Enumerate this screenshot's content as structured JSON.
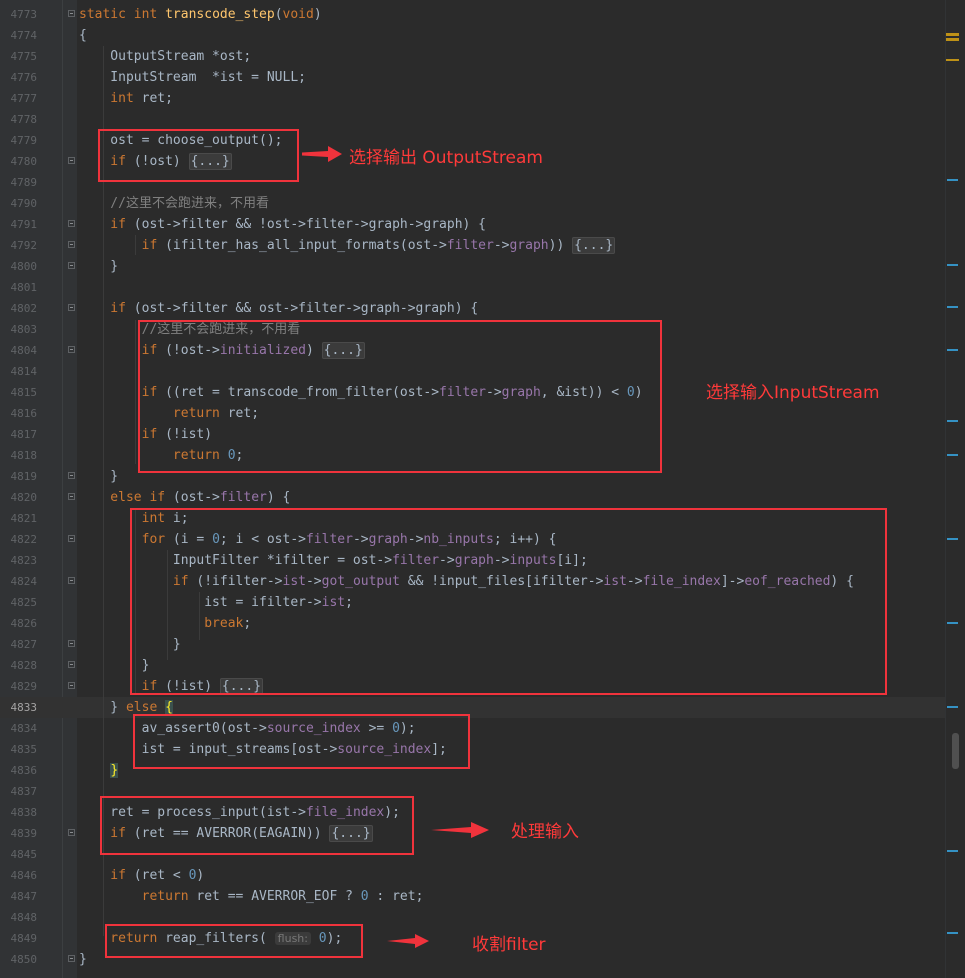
{
  "editor": {
    "lines": [
      {
        "n": "4773",
        "fold": true,
        "tokens": [
          [
            "kw",
            "static "
          ],
          [
            "kw",
            "int "
          ],
          [
            "fn",
            "transcode_step"
          ],
          [
            "",
            "("
          ],
          [
            "kw",
            "void"
          ],
          [
            "",
            ")"
          ]
        ]
      },
      {
        "n": "4774",
        "tokens": [
          [
            "",
            "{"
          ]
        ]
      },
      {
        "n": "4775",
        "tokens": [
          [
            "",
            "    OutputStream *ost;"
          ]
        ]
      },
      {
        "n": "4776",
        "tokens": [
          [
            "",
            "    InputStream  *ist = NULL;"
          ]
        ]
      },
      {
        "n": "4777",
        "tokens": [
          [
            "kw",
            "    int "
          ],
          [
            "",
            "ret;"
          ]
        ]
      },
      {
        "n": "4778",
        "tokens": []
      },
      {
        "n": "4779",
        "tokens": [
          [
            "",
            "    ost = choose_output();"
          ]
        ]
      },
      {
        "n": "4780",
        "fold": true,
        "tokens": [
          [
            "kw",
            "    if "
          ],
          [
            "",
            "(!ost) "
          ],
          [
            "fold",
            "{...}"
          ]
        ]
      },
      {
        "n": "4789",
        "tokens": []
      },
      {
        "n": "4790",
        "tokens": [
          [
            "cm",
            "    //这里不会跑进来，不用看"
          ]
        ]
      },
      {
        "n": "4791",
        "fold": true,
        "tokens": [
          [
            "kw",
            "    if "
          ],
          [
            "",
            "(ost->filter && !ost->filter->graph->graph) {"
          ]
        ]
      },
      {
        "n": "4792",
        "fold": true,
        "tokens": [
          [
            "kw",
            "        if "
          ],
          [
            "",
            "(ifilter_has_all_input_formats(ost->"
          ],
          [
            "fld",
            "filter"
          ],
          [
            "",
            "->"
          ],
          [
            "fld",
            "graph"
          ],
          [
            "",
            ")) "
          ],
          [
            "fold",
            "{...}"
          ]
        ]
      },
      {
        "n": "4800",
        "fold": true,
        "tokens": [
          [
            "",
            "    }"
          ]
        ]
      },
      {
        "n": "4801",
        "tokens": []
      },
      {
        "n": "4802",
        "fold": true,
        "tokens": [
          [
            "kw",
            "    if "
          ],
          [
            "",
            "(ost->filter && ost->filter->graph->graph) {"
          ]
        ]
      },
      {
        "n": "4803",
        "tokens": [
          [
            "cm",
            "        //这里不会跑进来，不用看"
          ]
        ]
      },
      {
        "n": "4804",
        "fold": true,
        "tokens": [
          [
            "kw",
            "        if "
          ],
          [
            "",
            "(!ost->"
          ],
          [
            "fld",
            "initialized"
          ],
          [
            "",
            ") "
          ],
          [
            "fold",
            "{...}"
          ]
        ]
      },
      {
        "n": "4814",
        "tokens": []
      },
      {
        "n": "4815",
        "tokens": [
          [
            "kw",
            "        if "
          ],
          [
            "",
            "((ret = transcode_from_filter(ost->"
          ],
          [
            "fld",
            "filter"
          ],
          [
            "",
            "->"
          ],
          [
            "fld",
            "graph"
          ],
          [
            "",
            ", &ist)) < "
          ],
          [
            "num",
            "0"
          ],
          [
            "",
            ")"
          ]
        ]
      },
      {
        "n": "4816",
        "tokens": [
          [
            "kw",
            "            return "
          ],
          [
            "",
            "ret;"
          ]
        ]
      },
      {
        "n": "4817",
        "tokens": [
          [
            "kw",
            "        if "
          ],
          [
            "",
            "(!ist)"
          ]
        ]
      },
      {
        "n": "4818",
        "tokens": [
          [
            "kw",
            "            return "
          ],
          [
            "num",
            "0"
          ],
          [
            "",
            ";"
          ]
        ]
      },
      {
        "n": "4819",
        "fold": true,
        "tokens": [
          [
            "",
            "    }"
          ]
        ]
      },
      {
        "n": "4820",
        "fold": true,
        "tokens": [
          [
            "kw",
            "    else if "
          ],
          [
            "",
            "(ost->"
          ],
          [
            "fld",
            "filter"
          ],
          [
            "",
            ") {"
          ]
        ]
      },
      {
        "n": "4821",
        "tokens": [
          [
            "kw",
            "        int "
          ],
          [
            "",
            "i;"
          ]
        ]
      },
      {
        "n": "4822",
        "fold": true,
        "tokens": [
          [
            "kw",
            "        for "
          ],
          [
            "",
            "(i = "
          ],
          [
            "num",
            "0"
          ],
          [
            "",
            "; i < ost->"
          ],
          [
            "fld",
            "filter"
          ],
          [
            "",
            "->"
          ],
          [
            "fld",
            "graph"
          ],
          [
            "",
            "->"
          ],
          [
            "fld",
            "nb_inputs"
          ],
          [
            "",
            "; i++) {"
          ]
        ]
      },
      {
        "n": "4823",
        "tokens": [
          [
            "",
            "            InputFilter *ifilter = ost->"
          ],
          [
            "fld",
            "filter"
          ],
          [
            "",
            "->"
          ],
          [
            "fld",
            "graph"
          ],
          [
            "",
            "->"
          ],
          [
            "fld",
            "inputs"
          ],
          [
            "",
            "[i];"
          ]
        ]
      },
      {
        "n": "4824",
        "fold": true,
        "tokens": [
          [
            "kw",
            "            if "
          ],
          [
            "",
            "(!ifilter->"
          ],
          [
            "fld",
            "ist"
          ],
          [
            "",
            "->"
          ],
          [
            "fld",
            "got_output"
          ],
          [
            "",
            " && !input_files[ifilter->"
          ],
          [
            "fld",
            "ist"
          ],
          [
            "",
            "->"
          ],
          [
            "fld",
            "file_index"
          ],
          [
            "",
            "]->"
          ],
          [
            "fld",
            "eof_reached"
          ],
          [
            "",
            ") {"
          ]
        ]
      },
      {
        "n": "4825",
        "tokens": [
          [
            "",
            "                ist = ifilter->"
          ],
          [
            "fld",
            "ist"
          ],
          [
            "",
            ";"
          ]
        ]
      },
      {
        "n": "4826",
        "tokens": [
          [
            "kw",
            "                break"
          ],
          [
            "",
            ";"
          ]
        ]
      },
      {
        "n": "4827",
        "fold": true,
        "tokens": [
          [
            "",
            "            }"
          ]
        ]
      },
      {
        "n": "4828",
        "fold": true,
        "tokens": [
          [
            "",
            "        }"
          ]
        ]
      },
      {
        "n": "4829",
        "fold": true,
        "tokens": [
          [
            "kw",
            "        if "
          ],
          [
            "",
            "(!ist) "
          ],
          [
            "fold",
            "{...}"
          ]
        ]
      },
      {
        "n": "4833",
        "current": true,
        "tokens": [
          [
            "",
            "    } "
          ],
          [
            "kw",
            "else "
          ],
          [
            "hl",
            "{"
          ]
        ]
      },
      {
        "n": "4834",
        "tokens": [
          [
            "",
            "        av_assert0(ost->"
          ],
          [
            "fld",
            "source_index"
          ],
          [
            "",
            " >= "
          ],
          [
            "num",
            "0"
          ],
          [
            "",
            ");"
          ]
        ]
      },
      {
        "n": "4835",
        "tokens": [
          [
            "",
            "        ist = input_streams[ost->"
          ],
          [
            "fld",
            "source_index"
          ],
          [
            "",
            "];"
          ]
        ]
      },
      {
        "n": "4836",
        "tokens": [
          [
            "",
            "    "
          ],
          [
            "hl",
            "}"
          ]
        ]
      },
      {
        "n": "4837",
        "tokens": []
      },
      {
        "n": "4838",
        "tokens": [
          [
            "",
            "    ret = process_input(ist->"
          ],
          [
            "fld",
            "file_index"
          ],
          [
            "",
            ");"
          ]
        ]
      },
      {
        "n": "4839",
        "fold": true,
        "tokens": [
          [
            "kw",
            "    if "
          ],
          [
            "",
            "(ret == AVERROR(EAGAIN)) "
          ],
          [
            "fold",
            "{...}"
          ]
        ]
      },
      {
        "n": "4845",
        "tokens": []
      },
      {
        "n": "4846",
        "tokens": [
          [
            "kw",
            "    if "
          ],
          [
            "",
            "(ret < "
          ],
          [
            "num",
            "0"
          ],
          [
            "",
            ")"
          ]
        ]
      },
      {
        "n": "4847",
        "tokens": [
          [
            "kw",
            "        return "
          ],
          [
            "",
            "ret == AVERROR_EOF ? "
          ],
          [
            "num",
            "0"
          ],
          [
            "",
            " : ret;"
          ]
        ]
      },
      {
        "n": "4848",
        "tokens": []
      },
      {
        "n": "4849",
        "tokens": [
          [
            "kw",
            "    return "
          ],
          [
            "",
            "reap_filters( "
          ],
          [
            "hint",
            "flush:"
          ],
          [
            "num",
            " 0"
          ],
          [
            "",
            ");"
          ]
        ]
      },
      {
        "n": "4850",
        "fold": true,
        "tokens": [
          [
            "",
            "}"
          ]
        ]
      }
    ]
  },
  "annotations": {
    "output": "选择输出 OutputStream",
    "input": "选择输入InputStream",
    "process": "处理输入",
    "reap": "收割filter"
  },
  "colors": {
    "annotation": "#f0333c",
    "background": "#2b2b2b",
    "keyword": "#cc7832",
    "function": "#ffc66d",
    "field": "#9876aa",
    "number": "#6897bb",
    "comment": "#808080"
  }
}
